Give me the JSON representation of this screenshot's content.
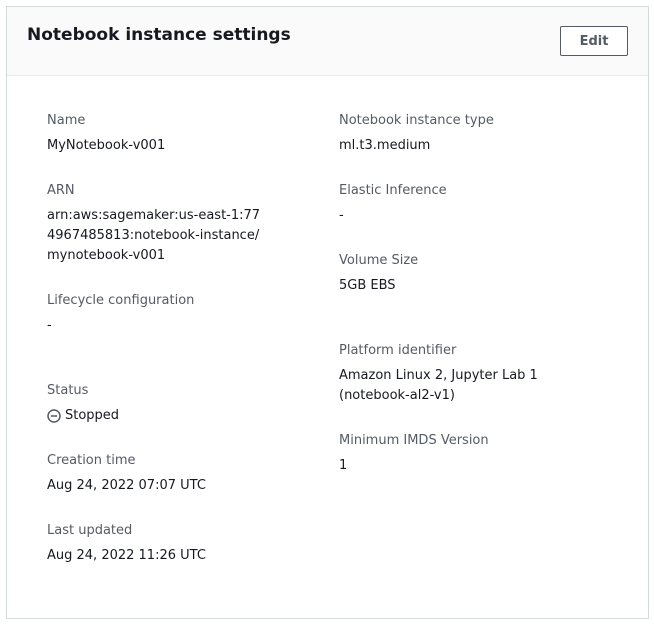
{
  "panel": {
    "title": "Notebook instance settings",
    "edit_label": "Edit"
  },
  "left": {
    "name": {
      "label": "Name",
      "value": "MyNotebook-v001"
    },
    "arn": {
      "label": "ARN",
      "value": "arn:aws:sagemaker:us-east-1:774967485813:notebook-instance/mynotebook-v001"
    },
    "lifecycle": {
      "label": "Lifecycle configuration",
      "value": "-"
    },
    "status": {
      "label": "Status",
      "value": "Stopped",
      "icon": "stopped-circle-icon"
    },
    "creation_time": {
      "label": "Creation time",
      "value": "Aug 24, 2022 07:07 UTC"
    },
    "last_updated": {
      "label": "Last updated",
      "value": "Aug 24, 2022 11:26 UTC"
    }
  },
  "right": {
    "instance_type": {
      "label": "Notebook instance type",
      "value": "ml.t3.medium"
    },
    "elastic_inference": {
      "label": "Elastic Inference",
      "value": "-"
    },
    "volume_size": {
      "label": "Volume Size",
      "value": "5GB EBS"
    },
    "platform_identifier": {
      "label": "Platform identifier",
      "value": "Amazon Linux 2, Jupyter Lab 1 (notebook-al2-v1)"
    },
    "imds_version": {
      "label": "Minimum IMDS Version",
      "value": "1"
    }
  }
}
